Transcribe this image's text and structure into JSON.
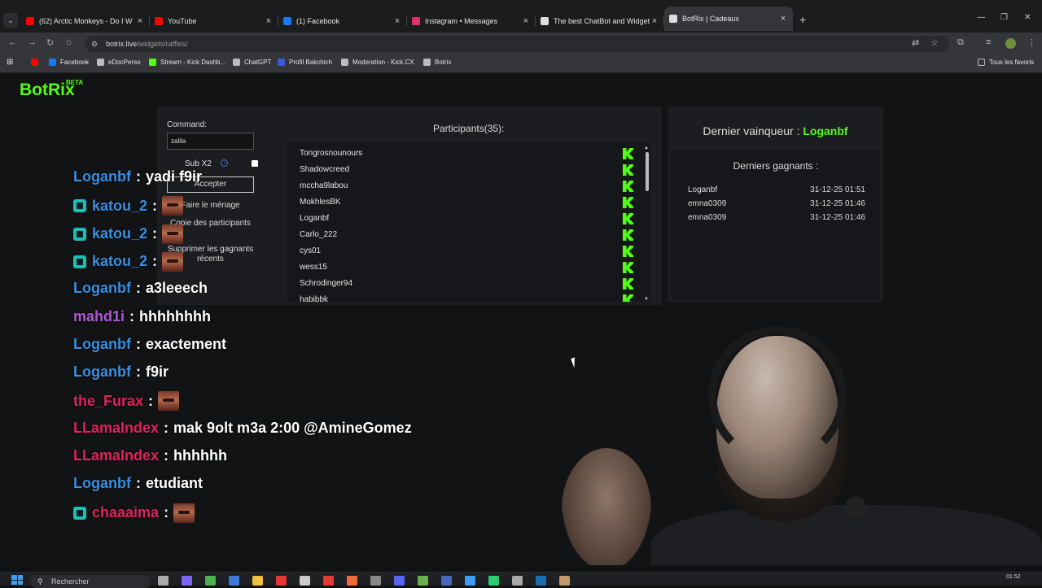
{
  "browser": {
    "tabs": [
      {
        "label": "(62) Arctic Monkeys - Do I W",
        "icon": "youtube-icon",
        "color": "#ff0000"
      },
      {
        "label": "YouTube",
        "icon": "youtube-icon",
        "color": "#ff0000"
      },
      {
        "label": "(1) Facebook",
        "icon": "facebook-icon",
        "color": "#1877f2"
      },
      {
        "label": "Instagram • Messages",
        "icon": "instagram-icon",
        "color": "#e1306c"
      },
      {
        "label": "The best ChatBot and Widgets",
        "icon": "botrix-icon",
        "color": "#dddddd"
      },
      {
        "label": "BotRix | Cadeaux",
        "icon": "botrix-icon",
        "color": "#dddddd"
      }
    ],
    "tab_close": "×",
    "new_tab": "+",
    "url_host": "botrix.live",
    "url_path": "/widgets/raffles/",
    "bookmarks": [
      {
        "label": "",
        "icon": "youtube-icon",
        "color": "#ff0000"
      },
      {
        "label": "Facebook",
        "icon": "facebook-icon",
        "color": "#1877f2"
      },
      {
        "label": "eDocPerso",
        "icon": "edoc-icon",
        "color": "#bbbbbb"
      },
      {
        "label": "Stream - Kick Dashb...",
        "icon": "kick-icon",
        "color": "#53fc18"
      },
      {
        "label": "ChatGPT",
        "icon": "chatgpt-icon",
        "color": "#bbbbbb"
      },
      {
        "label": "Profil Bakchich",
        "icon": "bakchich-icon",
        "color": "#3b5bdb"
      },
      {
        "label": "Moderation - Kick.CX",
        "icon": "kickcx-icon",
        "color": "#bbbbbb"
      },
      {
        "label": "Botrix",
        "icon": "botrix-icon",
        "color": "#bbbbbb"
      }
    ],
    "all_bookmarks": "Tous les favoris"
  },
  "app": {
    "logo": "BotRix",
    "logo_badge": "BETA",
    "accent": "#53fc18"
  },
  "raffle": {
    "command_label": "Command:",
    "command_value": "zalila",
    "sub_label": "Sub X2",
    "accept_button": "Accepter",
    "clean_button": "Faire le ménage",
    "copy_button": "Copie des participants",
    "delete_button": "Supprimer les gagnants récents",
    "participants_title": "Participants(35):",
    "participants": [
      "Tongrosnounours",
      "Shadowcreed",
      "mccha9labou",
      "MokhlesBK",
      "Loganbf",
      "Carlo_222",
      "cys01",
      "wess15",
      "Schrodinger94",
      "habibbk"
    ]
  },
  "winners": {
    "last_winner_label": "Dernier vainqueur :",
    "last_winner": "Loganbf",
    "recent_title": "Derniers gagnants :",
    "recent": [
      {
        "name": "Loganbf",
        "date": "31-12-25 01:51"
      },
      {
        "name": "emna0309",
        "date": "31-12-25 01:46"
      },
      {
        "name": "emna0309",
        "date": "31-12-25 01:46"
      }
    ]
  },
  "chat": [
    {
      "user": "Loganbf",
      "color": "#3a8fe0",
      "msg": "yadi f9ir",
      "sub": false,
      "emote": false
    },
    {
      "user": "katou_2",
      "color": "#3a8fe0",
      "msg": "",
      "sub": true,
      "emote": true
    },
    {
      "user": "katou_2",
      "color": "#3a8fe0",
      "msg": "",
      "sub": true,
      "emote": true
    },
    {
      "user": "katou_2",
      "color": "#3a8fe0",
      "msg": "",
      "sub": true,
      "emote": true
    },
    {
      "user": "Loganbf",
      "color": "#3a8fe0",
      "msg": "a3leeech",
      "sub": false,
      "emote": false
    },
    {
      "user": "mahd1i",
      "color": "#b05ad8",
      "msg": "hhhhhhhh",
      "sub": false,
      "emote": false
    },
    {
      "user": "Loganbf",
      "color": "#3a8fe0",
      "msg": "exactement",
      "sub": false,
      "emote": false
    },
    {
      "user": "Loganbf",
      "color": "#3a8fe0",
      "msg": "f9ir",
      "sub": false,
      "emote": false
    },
    {
      "user": "the_Furax",
      "color": "#e0245e",
      "msg": "",
      "sub": false,
      "emote": true
    },
    {
      "user": "LLamaIndex",
      "color": "#e0245e",
      "msg": "mak 9olt m3a 2:00 @AmineGomez",
      "sub": false,
      "emote": false
    },
    {
      "user": "LLamaIndex",
      "color": "#e0245e",
      "msg": "hhhhhh",
      "sub": false,
      "emote": false
    },
    {
      "user": "Loganbf",
      "color": "#3a8fe0",
      "msg": "etudiant",
      "sub": false,
      "emote": false
    },
    {
      "user": "chaaaima",
      "color": "#e0245e",
      "msg": "",
      "sub": true,
      "emote": true
    }
  ],
  "taskbar": {
    "search_placeholder": "Rechercher",
    "time": "01:52"
  }
}
